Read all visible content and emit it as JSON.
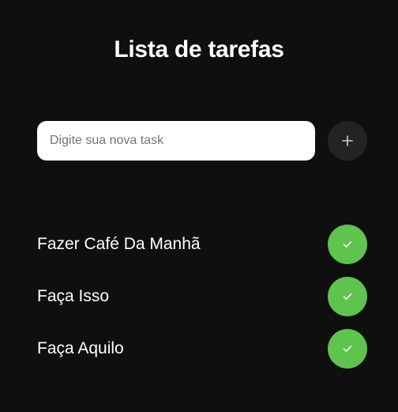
{
  "header": {
    "title": "Lista de tarefas"
  },
  "new_task": {
    "value": "",
    "placeholder": "Digite sua nova task",
    "add_button_icon": "plus-icon"
  },
  "tasks": [
    {
      "label": "Fazer Café Da Manhã",
      "action_icon": "check-icon"
    },
    {
      "label": "Faça Isso",
      "action_icon": "check-icon"
    },
    {
      "label": "Faça Aquilo",
      "action_icon": "check-icon"
    }
  ],
  "colors": {
    "background": "#0f0f0f",
    "text": "#ffffff",
    "input_background": "#ffffff",
    "add_button_background": "#232323",
    "done_button_background": "#5ec44e"
  }
}
